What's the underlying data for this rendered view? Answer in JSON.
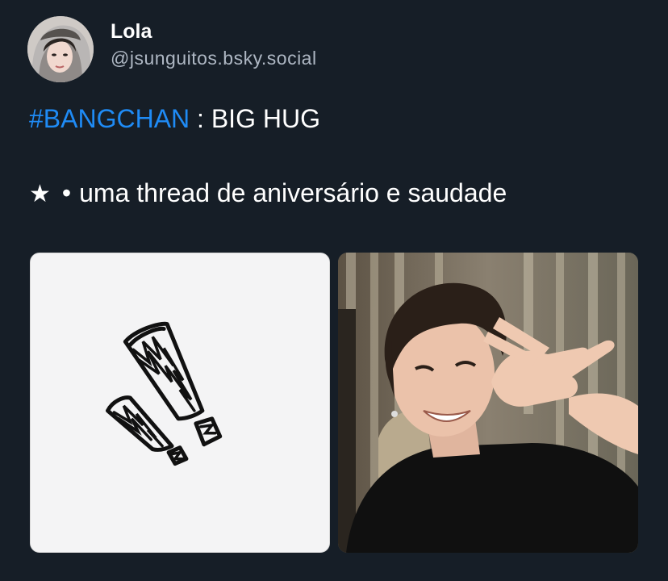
{
  "author": {
    "display_name": "Lola",
    "handle": "@jsunguitos.bsky.social",
    "avatar_icon": "user-avatar"
  },
  "post": {
    "hashtag": "#BANGCHAN",
    "line1_rest": " : BIG HUG",
    "star": "★",
    "bullet": "•",
    "line2_text": "uma thread de aniversário e saudade"
  },
  "colors": {
    "background": "#161e27",
    "hashtag": "#1f8bf5",
    "handle": "#aeb7c3"
  },
  "media": [
    {
      "kind": "illustration",
      "icon": "double-exclamation-drawing"
    },
    {
      "kind": "photo",
      "icon": "person-photo-peace-sign"
    }
  ]
}
